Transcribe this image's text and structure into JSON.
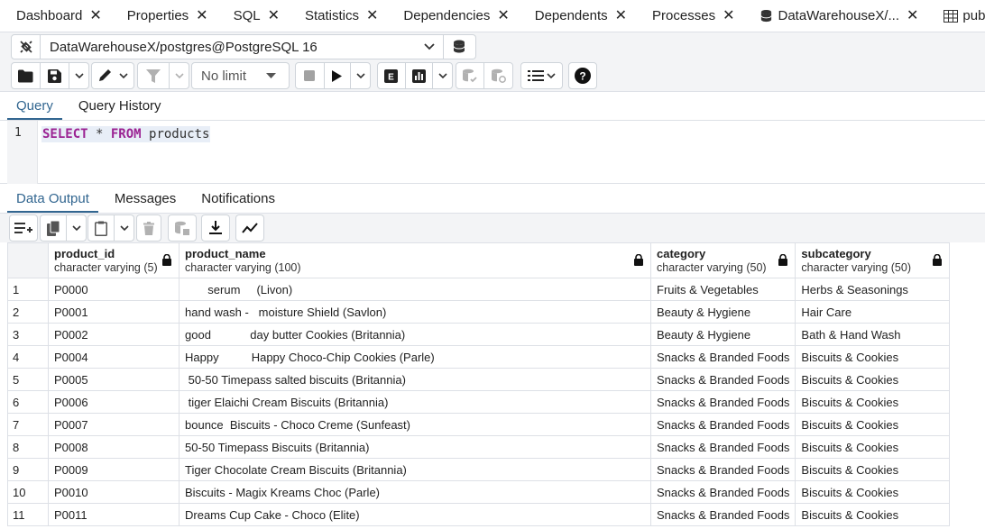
{
  "tabs": [
    {
      "label": "Dashboard",
      "icon": null
    },
    {
      "label": "Properties",
      "icon": null
    },
    {
      "label": "SQL",
      "icon": null
    },
    {
      "label": "Statistics",
      "icon": null
    },
    {
      "label": "Dependencies",
      "icon": null
    },
    {
      "label": "Dependents",
      "icon": null
    },
    {
      "label": "Processes",
      "icon": null
    },
    {
      "label": "DataWarehouseX/...",
      "icon": "database-icon"
    },
    {
      "label": "public.category/D...",
      "icon": "table-icon"
    }
  ],
  "connection": {
    "label": "DataWarehouseX/postgres@PostgreSQL 16"
  },
  "toolbar": {
    "limit_label": "No limit"
  },
  "editor_tabs": {
    "query": "Query",
    "history": "Query History"
  },
  "editor": {
    "line_number": "1",
    "kw_select": "SELECT",
    "star": " * ",
    "kw_from": "FROM",
    "table": " products"
  },
  "output_tabs": {
    "data_output": "Data Output",
    "messages": "Messages",
    "notifications": "Notifications"
  },
  "grid": {
    "columns": [
      {
        "name": "product_id",
        "type": "character varying (5)"
      },
      {
        "name": "product_name",
        "type": "character varying (100)"
      },
      {
        "name": "category",
        "type": "character varying (50)"
      },
      {
        "name": "subcategory",
        "type": "character varying (50)"
      }
    ],
    "rows": [
      {
        "n": "1",
        "id": "P0000",
        "name": "       serum     (Livon)",
        "category": "Fruits & Vegetables",
        "sub": "Herbs & Seasonings"
      },
      {
        "n": "2",
        "id": "P0001",
        "name": "hand wash -   moisture Shield (Savlon)",
        "category": "Beauty & Hygiene",
        "sub": "Hair Care"
      },
      {
        "n": "3",
        "id": "P0002",
        "name": "good            day butter Cookies (Britannia)",
        "category": "Beauty & Hygiene",
        "sub": "Bath & Hand Wash"
      },
      {
        "n": "4",
        "id": "P0004",
        "name": "Happy          Happy Choco-Chip Cookies (Parle)",
        "category": "Snacks & Branded Foods",
        "sub": "Biscuits & Cookies"
      },
      {
        "n": "5",
        "id": "P0005",
        "name": " 50-50 Timepass salted biscuits (Britannia)",
        "category": "Snacks & Branded Foods",
        "sub": "Biscuits & Cookies"
      },
      {
        "n": "6",
        "id": "P0006",
        "name": " tiger Elaichi Cream Biscuits (Britannia)",
        "category": "Snacks & Branded Foods",
        "sub": "Biscuits & Cookies"
      },
      {
        "n": "7",
        "id": "P0007",
        "name": "bounce  Biscuits - Choco Creme (Sunfeast)",
        "category": "Snacks & Branded Foods",
        "sub": "Biscuits & Cookies"
      },
      {
        "n": "8",
        "id": "P0008",
        "name": "50-50 Timepass Biscuits (Britannia)",
        "category": "Snacks & Branded Foods",
        "sub": "Biscuits & Cookies"
      },
      {
        "n": "9",
        "id": "P0009",
        "name": "Tiger Chocolate Cream Biscuits (Britannia)",
        "category": "Snacks & Branded Foods",
        "sub": "Biscuits & Cookies"
      },
      {
        "n": "10",
        "id": "P0010",
        "name": "Biscuits - Magix Kreams Choc (Parle)",
        "category": "Snacks & Branded Foods",
        "sub": "Biscuits & Cookies"
      },
      {
        "n": "11",
        "id": "P0011",
        "name": "Dreams Cup Cake - Choco (Elite)",
        "category": "Snacks & Branded Foods",
        "sub": "Biscuits & Cookies"
      }
    ]
  },
  "colors": {
    "accent": "#326690",
    "keyword": "#9b2393",
    "border": "#dde0e6",
    "panel": "#f3f4f6"
  }
}
